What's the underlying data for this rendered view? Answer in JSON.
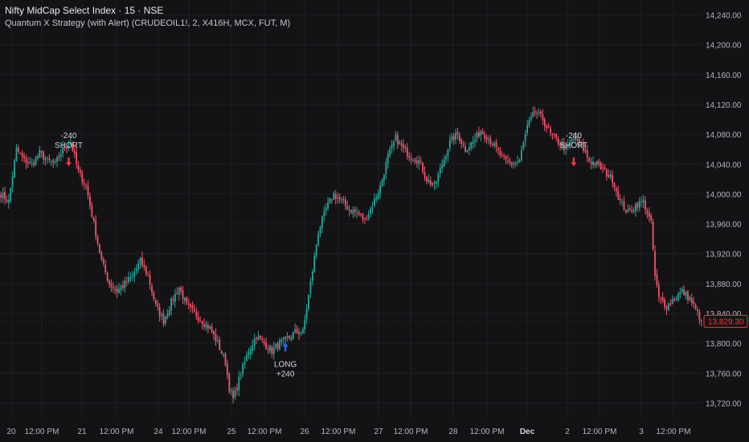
{
  "header": {
    "symbol_line": "Nifty MidCap Select Index · 15 · NSE",
    "strategy_line": "Quantum X Strategy (with Alert) (CRUDEOIL1!, 2, X416H, MCX, FUT, M)"
  },
  "colors": {
    "background": "#131315",
    "grid": "#1e1f24",
    "up": "#26a69a",
    "down": "#ef5369",
    "axis_text": "#b2b5be",
    "long_marker": "#2962ff",
    "short_marker": "#f23645",
    "price_tag_border": "#f23645",
    "price_tag_text": "#f23645"
  },
  "chart_data": {
    "type": "candlestick",
    "ylim": [
      13700,
      14260
    ],
    "y_ticks": [
      14240,
      14200,
      14160,
      14120,
      14080,
      14040,
      14000,
      13960,
      13920,
      13880,
      13840,
      13800,
      13760,
      13720
    ],
    "x_tick_labels": [
      "20",
      "12:00 PM",
      "21",
      "12:00 PM",
      "24",
      "12:00 PM",
      "25",
      "12:00 PM",
      "26",
      "12:00 PM",
      "27",
      "12:00 PM",
      "28",
      "12:00 PM",
      "Dec",
      "2",
      "12:00 PM",
      "3",
      "12:00 PM"
    ],
    "last_price_label": "13,829.30",
    "last_price": 13829.3,
    "anchors": [
      [
        0,
        14000
      ],
      [
        4,
        13990
      ],
      [
        8,
        14060
      ],
      [
        12,
        14045
      ],
      [
        16,
        14040
      ],
      [
        20,
        14055
      ],
      [
        24,
        14045
      ],
      [
        28,
        14040
      ],
      [
        32,
        14060
      ],
      [
        36,
        14070
      ],
      [
        40,
        14030
      ],
      [
        44,
        14010
      ],
      [
        48,
        13960
      ],
      [
        52,
        13910
      ],
      [
        56,
        13880
      ],
      [
        60,
        13870
      ],
      [
        64,
        13880
      ],
      [
        68,
        13890
      ],
      [
        72,
        13910
      ],
      [
        76,
        13890
      ],
      [
        80,
        13850
      ],
      [
        84,
        13830
      ],
      [
        88,
        13855
      ],
      [
        92,
        13875
      ],
      [
        96,
        13850
      ],
      [
        100,
        13840
      ],
      [
        104,
        13830
      ],
      [
        108,
        13820
      ],
      [
        112,
        13800
      ],
      [
        116,
        13775
      ],
      [
        118,
        13740
      ],
      [
        120,
        13725
      ],
      [
        124,
        13760
      ],
      [
        128,
        13790
      ],
      [
        132,
        13810
      ],
      [
        136,
        13800
      ],
      [
        140,
        13790
      ],
      [
        144,
        13800
      ],
      [
        148,
        13805
      ],
      [
        152,
        13815
      ],
      [
        156,
        13815
      ],
      [
        160,
        13880
      ],
      [
        164,
        13950
      ],
      [
        168,
        13980
      ],
      [
        172,
        14000
      ],
      [
        176,
        13990
      ],
      [
        180,
        13980
      ],
      [
        184,
        13975
      ],
      [
        188,
        13965
      ],
      [
        192,
        13985
      ],
      [
        196,
        14010
      ],
      [
        200,
        14050
      ],
      [
        204,
        14075
      ],
      [
        208,
        14060
      ],
      [
        212,
        14050
      ],
      [
        216,
        14045
      ],
      [
        220,
        14020
      ],
      [
        224,
        14010
      ],
      [
        228,
        14040
      ],
      [
        232,
        14070
      ],
      [
        236,
        14080
      ],
      [
        240,
        14060
      ],
      [
        244,
        14070
      ],
      [
        248,
        14085
      ],
      [
        252,
        14075
      ],
      [
        256,
        14060
      ],
      [
        260,
        14045
      ],
      [
        264,
        14040
      ],
      [
        268,
        14045
      ],
      [
        272,
        14090
      ],
      [
        276,
        14110
      ],
      [
        280,
        14100
      ],
      [
        284,
        14080
      ],
      [
        288,
        14070
      ],
      [
        292,
        14060
      ],
      [
        296,
        14075
      ],
      [
        300,
        14065
      ],
      [
        304,
        14045
      ],
      [
        308,
        14040
      ],
      [
        312,
        14030
      ],
      [
        316,
        14020
      ],
      [
        320,
        13990
      ],
      [
        324,
        13975
      ],
      [
        328,
        13985
      ],
      [
        332,
        13990
      ],
      [
        336,
        13960
      ],
      [
        338,
        13890
      ],
      [
        340,
        13860
      ],
      [
        344,
        13850
      ],
      [
        348,
        13860
      ],
      [
        352,
        13870
      ],
      [
        356,
        13860
      ],
      [
        360,
        13840
      ],
      [
        362,
        13829.3
      ]
    ],
    "bars_total": 363,
    "session_gaps": [
      115,
      154,
      208,
      242,
      275,
      296,
      326
    ],
    "trades": [
      {
        "side": "SHORT",
        "pnl": "-240",
        "bar": 35,
        "price": 14048,
        "label_side": "SHORT",
        "label_pnl": "-240"
      },
      {
        "side": "LONG",
        "pnl": "+240",
        "bar": 147,
        "price": 13790,
        "label_side": "LONG",
        "label_pnl": "+240"
      },
      {
        "side": "SHORT",
        "pnl": "-240",
        "bar": 296,
        "price": 14048,
        "label_side": "SHORT",
        "label_pnl": "-240"
      }
    ]
  }
}
